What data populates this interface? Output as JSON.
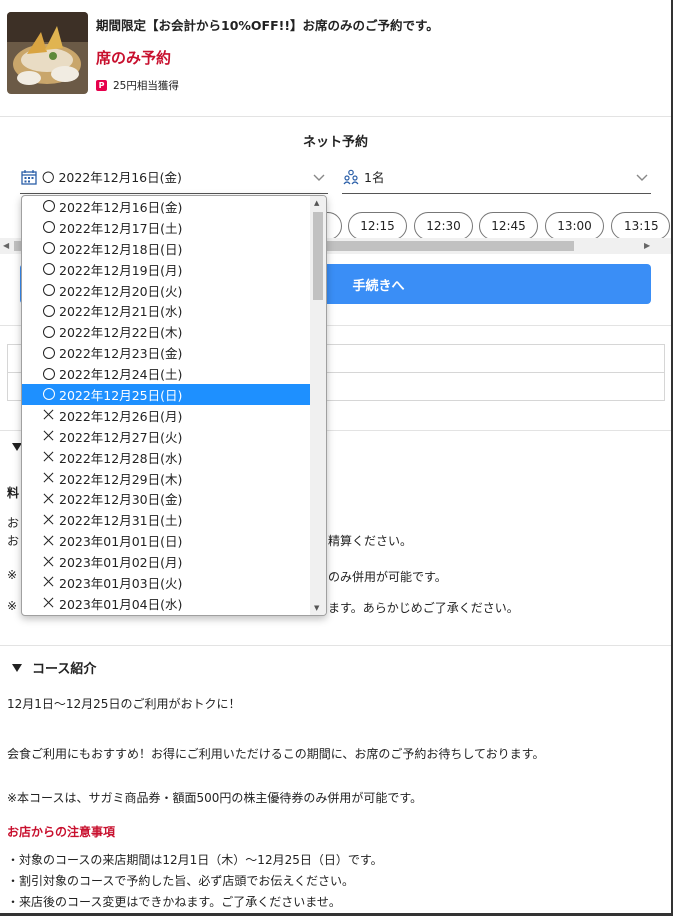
{
  "header": {
    "promo": "期間限定【お会計から10%OFF!!】お席のみのご予約です。",
    "course_title": "席のみ予約",
    "points_icon": "P",
    "points": "25円相当獲得"
  },
  "reservation": {
    "title": "ネット予約",
    "selected_date": "〇 2022年12月16日(金)",
    "people": "1名",
    "times": [
      "12:15",
      "12:30",
      "12:45",
      "13:00",
      "13:15"
    ],
    "proceed_label": "手続きへ"
  },
  "dropdown": {
    "items": [
      {
        "mark": "circle",
        "label": "2022年12月16日(金)"
      },
      {
        "mark": "circle",
        "label": "2022年12月17日(土)"
      },
      {
        "mark": "circle",
        "label": "2022年12月18日(日)"
      },
      {
        "mark": "circle",
        "label": "2022年12月19日(月)"
      },
      {
        "mark": "circle",
        "label": "2022年12月20日(火)"
      },
      {
        "mark": "circle",
        "label": "2022年12月21日(水)"
      },
      {
        "mark": "circle",
        "label": "2022年12月22日(木)"
      },
      {
        "mark": "circle",
        "label": "2022年12月23日(金)"
      },
      {
        "mark": "circle",
        "label": "2022年12月24日(土)"
      },
      {
        "mark": "circle",
        "label": "2022年12月25日(日)",
        "selected": true
      },
      {
        "mark": "cross",
        "label": "2022年12月26日(月)"
      },
      {
        "mark": "cross",
        "label": "2022年12月27日(火)"
      },
      {
        "mark": "cross",
        "label": "2022年12月28日(水)"
      },
      {
        "mark": "cross",
        "label": "2022年12月29日(木)"
      },
      {
        "mark": "cross",
        "label": "2022年12月30日(金)"
      },
      {
        "mark": "cross",
        "label": "2022年12月31日(土)"
      },
      {
        "mark": "cross",
        "label": "2023年01月01日(日)"
      },
      {
        "mark": "cross",
        "label": "2023年01月02日(月)"
      },
      {
        "mark": "cross",
        "label": "2023年01月03日(火)"
      },
      {
        "mark": "cross",
        "label": "2023年01月04日(水)"
      }
    ]
  },
  "price_section": {
    "head_fragment": "料",
    "line1_fragment": "お",
    "line2_fragment": "お",
    "line2_tail": "精算ください。",
    "note1_fragment": "※",
    "note1_tail": "のみ併用が可能です。",
    "note2_fragment": "※",
    "note2_tail": "ます。あらかじめご了承ください。"
  },
  "course_intro": {
    "heading": "コース紹介",
    "line1": "12月1日～12月25日のご利用がおトクに！",
    "line2": "会食ご利用にもおすすめ！お得にご利用いただけるこの期間に、お席のご予約お待ちしております。",
    "line3": "※本コースは、サガミ商品券・額面500円の株主優待券のみ併用が可能です。",
    "notice_heading": "お店からの注意事項",
    "notices": [
      "・対象のコースの来店期間は12月1日（木）～12月25日（日）です。",
      "・割引対象のコースで予約した旨、必ず店頭でお伝えください。",
      "・来店後のコース変更はできかねます。ご了承くださいませ。"
    ]
  },
  "colors": {
    "accent_red": "#c8102e",
    "proceed_blue": "#3a8ef6",
    "selected_blue": "#1e90ff",
    "points_pink": "#e6004c"
  }
}
